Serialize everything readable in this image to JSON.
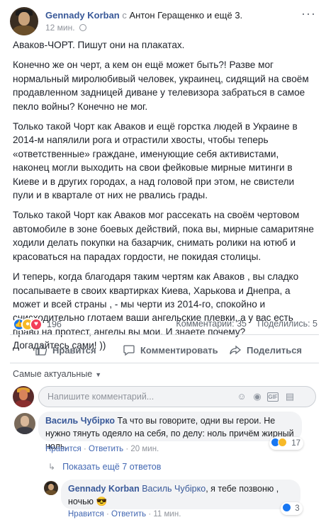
{
  "post": {
    "author": "Gennady Korban",
    "with_prefix": "с",
    "tagged": "Антон Геращенко",
    "and_others": "и ещё 3.",
    "time": "12 мин.",
    "more_icon": "ellipsis-icon",
    "paragraphs": [
      "Аваков-ЧОРТ. Пишут они на плакатах.",
      "Конечно же он черт, а кем он ещё может быть?! Разве мог нормальный миролюбивый человек, украинец, сидящий на своём продавленном задницей диване у телевизора забраться в самое пекло войны? Конечно не мог.",
      "Только такой Чорт как Аваков и ещё горстка людей в Украине в 2014-м напялили рога и отрастили хвосты, чтобы теперь «ответственные» граждане, именующие себя активистами, наконец могли выходить на свои фейковые мирные митинги в Киеве и в других городах, а над головой при этом, не свистели пули и в квартале от них не рвались грады.",
      "Только такой Чорт как Аваков мог рассекать на своём чертовом автомобиле в зоне боевых действий, пока вы, мирные самаритяне ходили делать покупки на базарчик, снимать ролики на ютюб и красоваться на парадах гордости, не покидая столицы.",
      "И теперь, когда благодаря таким чертям как Аваков , вы сладко посапываете в своих квартирках Киева, Харькова и Днепра, а может и всей страны , - мы черти из 2014-го, спокойно и снисходительно глотаем ваши ангельские плевки, а у вас есть право на протест, ангелы вы мои. И знаете почему?",
      "Догадайтесь сами! ))"
    ]
  },
  "stats": {
    "reaction_count": "196",
    "comments": "Комментарии: 35",
    "shares": "Поделились: 5"
  },
  "actions": {
    "like": "Нравится",
    "comment": "Комментировать",
    "share": "Поделиться"
  },
  "filter": {
    "label": "Самые актуальные"
  },
  "comment_input": {
    "placeholder": "Напишите комментарий..."
  },
  "comments": [
    {
      "author": "Василь Чубірко",
      "text": "Та что вы говорите, одни вы герои. Не нужно тянуть одеяло на себя, по делу: ноль причём жирный ноль.",
      "like": "Нравится",
      "reply": "Ответить",
      "time": "20 мин.",
      "reactions": "17"
    }
  ],
  "more_replies": "Показать ещё 7 ответов",
  "reply": {
    "author": "Gennady Korban",
    "mention": "Василь Чубірко",
    "text": ", я тебе позвоню , ночью 😎",
    "like": "Нравится",
    "reply": "Ответить",
    "time": "11 мин.",
    "reactions": "3"
  },
  "colors": {
    "link": "#385898",
    "like_blue": "#1877f2",
    "love_red": "#f33e58",
    "wow_yellow": "#f7b928"
  }
}
